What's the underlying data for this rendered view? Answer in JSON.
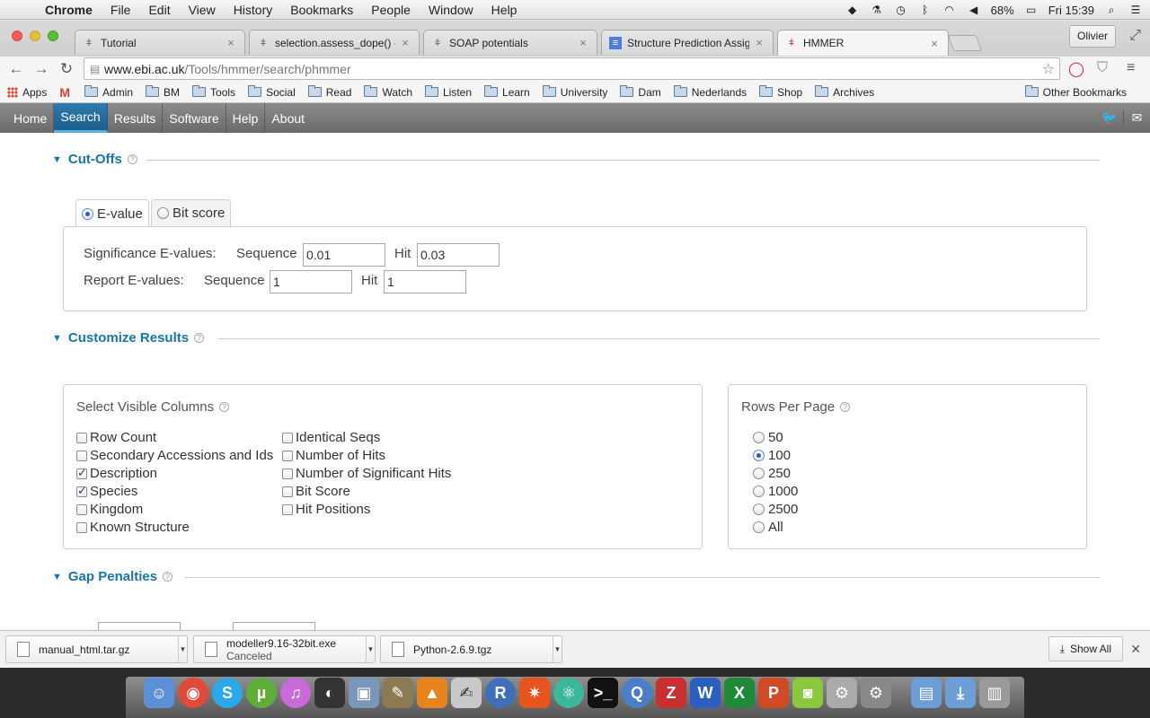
{
  "menubar": {
    "app": "Chrome",
    "items": [
      "File",
      "Edit",
      "View",
      "History",
      "Bookmarks",
      "People",
      "Window",
      "Help"
    ],
    "battery": "68%",
    "clock": "Fri 15:39"
  },
  "tabs": [
    {
      "title": "Tutorial",
      "active": false
    },
    {
      "title": "selection.assess_dope() --",
      "active": false
    },
    {
      "title": "SOAP potentials",
      "active": false
    },
    {
      "title": "Structure Prediction Assign",
      "active": false
    },
    {
      "title": "HMMER",
      "active": true
    }
  ],
  "profile": "Olivier",
  "address": {
    "host": "www.ebi.ac.uk",
    "path": "/Tools/hmmer/search/phmmer"
  },
  "bookmarks": {
    "items": [
      "Apps",
      "Admin",
      "BM",
      "Tools",
      "Social",
      "Read",
      "Watch",
      "Listen",
      "Learn",
      "University",
      "Dam",
      "Nederlands",
      "Shop",
      "Archives"
    ],
    "other": "Other Bookmarks"
  },
  "sitenav": [
    "Home",
    "Search",
    "Results",
    "Software",
    "Help",
    "About"
  ],
  "cutoffs": {
    "title": "Cut-Offs",
    "tabs": [
      "E-value",
      "Bit score"
    ],
    "significance_label": "Significance E-values:",
    "report_label": "Report E-values:",
    "sequence_label": "Sequence",
    "hit_label": "Hit",
    "sig_sequence": "0.01",
    "sig_hit": "0.03",
    "rep_sequence": "1",
    "rep_hit": "1"
  },
  "customize": {
    "title": "Customize Results",
    "columns_title": "Select Visible Columns",
    "columns_left": [
      {
        "label": "Row Count",
        "checked": false
      },
      {
        "label": "Secondary Accessions and Ids",
        "checked": false
      },
      {
        "label": "Description",
        "checked": true
      },
      {
        "label": "Species",
        "checked": true
      },
      {
        "label": "Kingdom",
        "checked": false
      },
      {
        "label": "Known Structure",
        "checked": false
      }
    ],
    "columns_right": [
      {
        "label": "Identical Seqs",
        "checked": false
      },
      {
        "label": "Number of Hits",
        "checked": false
      },
      {
        "label": "Number of Significant Hits",
        "checked": false
      },
      {
        "label": "Bit Score",
        "checked": false
      },
      {
        "label": "Hit Positions",
        "checked": false
      }
    ],
    "rows_title": "Rows Per Page",
    "rows_options": [
      {
        "label": "50",
        "selected": false
      },
      {
        "label": "100",
        "selected": true
      },
      {
        "label": "250",
        "selected": false
      },
      {
        "label": "1000",
        "selected": false
      },
      {
        "label": "2500",
        "selected": false
      },
      {
        "label": "All",
        "selected": false
      }
    ]
  },
  "gap": {
    "title": "Gap Penalties"
  },
  "downloads": [
    {
      "name": "manual_html.tar.gz",
      "status": ""
    },
    {
      "name": "modeller9.16-32bit.exe",
      "status": "Canceled"
    },
    {
      "name": "Python-2.6.9.tgz",
      "status": ""
    }
  ],
  "show_all": "Show All",
  "colors": {
    "accent": "#1a75a6",
    "nav_active": "#1d5e8c"
  }
}
